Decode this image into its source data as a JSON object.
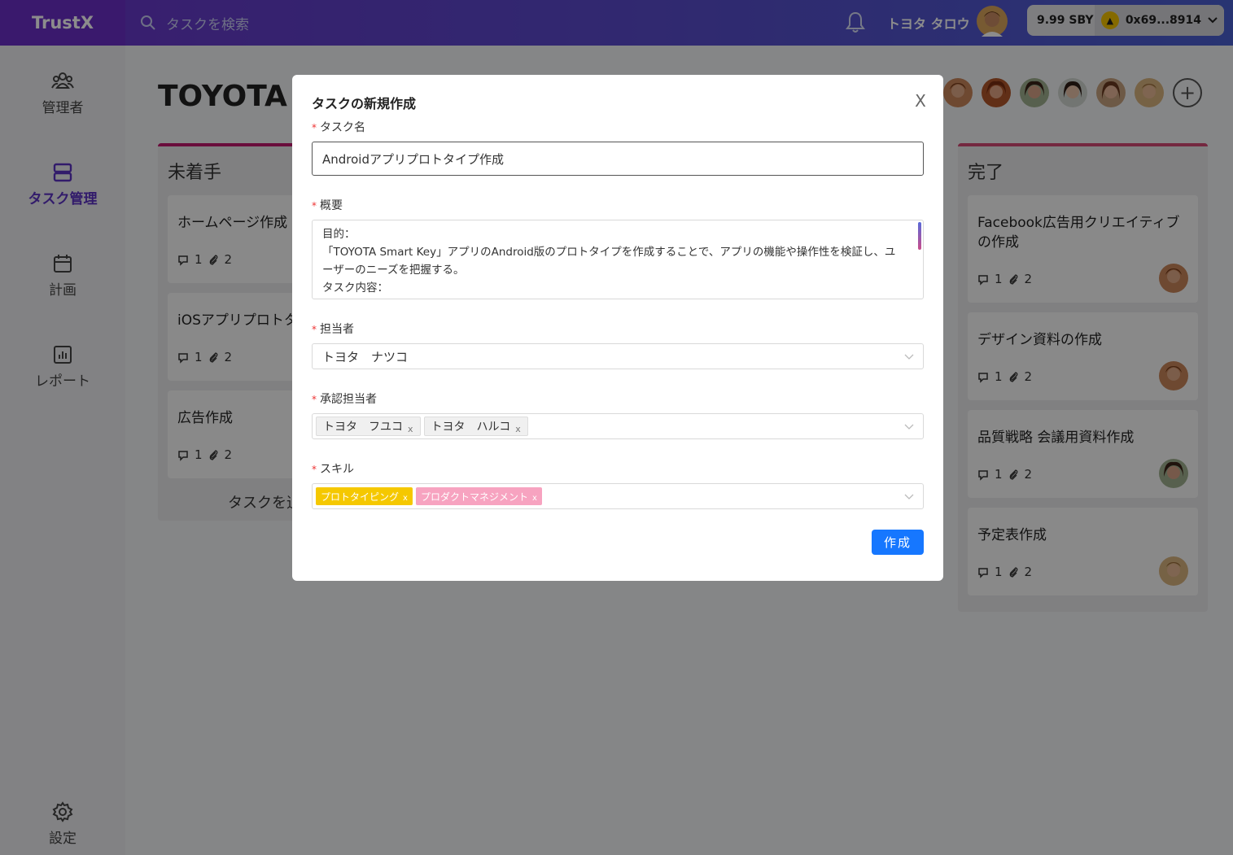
{
  "app": {
    "logo": "TrustX",
    "search_placeholder": "タスクを検索",
    "user_name": "トヨタ タロウ",
    "wallet_balance": "9.99 SBY",
    "wallet_address": "0x69...8914"
  },
  "sidebar": {
    "items": [
      {
        "label": "管理者",
        "icon": "users-icon"
      },
      {
        "label": "タスク管理",
        "icon": "tasks-icon",
        "active": true
      },
      {
        "label": "計画",
        "icon": "calendar-icon"
      },
      {
        "label": "レポート",
        "icon": "report-icon"
      }
    ],
    "settings_label": "設定"
  },
  "board": {
    "project_title": "TOYOTA S",
    "columns": [
      {
        "title": "未着手",
        "cards": [
          {
            "title": "ホームページ作成",
            "comments": "1",
            "attachments": "2"
          },
          {
            "title": "iOSアプリプロトタ",
            "comments": "1",
            "attachments": "2"
          },
          {
            "title": "広告作成",
            "comments": "1",
            "attachments": "2"
          }
        ],
        "add_label": "タスクを追"
      },
      {
        "title": "完了",
        "cards": [
          {
            "title": "Facebook広告用クリエイティブの作成",
            "comments": "1",
            "attachments": "2"
          },
          {
            "title": "デザイン資料の作成",
            "comments": "1",
            "attachments": "2"
          },
          {
            "title": "品質戦略 会議用資料作成",
            "comments": "1",
            "attachments": "2"
          },
          {
            "title": "予定表作成",
            "comments": "1",
            "attachments": "2"
          }
        ]
      }
    ]
  },
  "modal": {
    "title": "タスクの新規作成",
    "close": "X",
    "task_name_label": "タスク名",
    "task_name_value": "Androidアプリプロトタイプ作成",
    "summary_label": "概要",
    "summary_lines": [
      "目的：",
      "「TOYOTA Smart Key」アプリのAndroid版のプロトタイプを作成することで、アプリの機能や操作性を検証し、ユ",
      "ーザーのニーズを把握する。",
      "タスク内容："
    ],
    "assignee_label": "担当者",
    "assignee_value": "トヨタ　ナツコ",
    "approver_label": "承認担当者",
    "approvers": [
      "トヨタ　フユコ",
      "トヨタ　ハルコ"
    ],
    "skill_label": "スキル",
    "skills": [
      {
        "name": "プロトタイピング",
        "color": "#f5c800"
      },
      {
        "name": "プロダクトマネジメント",
        "color": "#f7a3c0"
      }
    ],
    "tag_remove": "x",
    "create_button": "作成"
  },
  "colors": {
    "accent": "#6a2fc6",
    "primary_button": "#1677ff",
    "required": "#e33333"
  }
}
